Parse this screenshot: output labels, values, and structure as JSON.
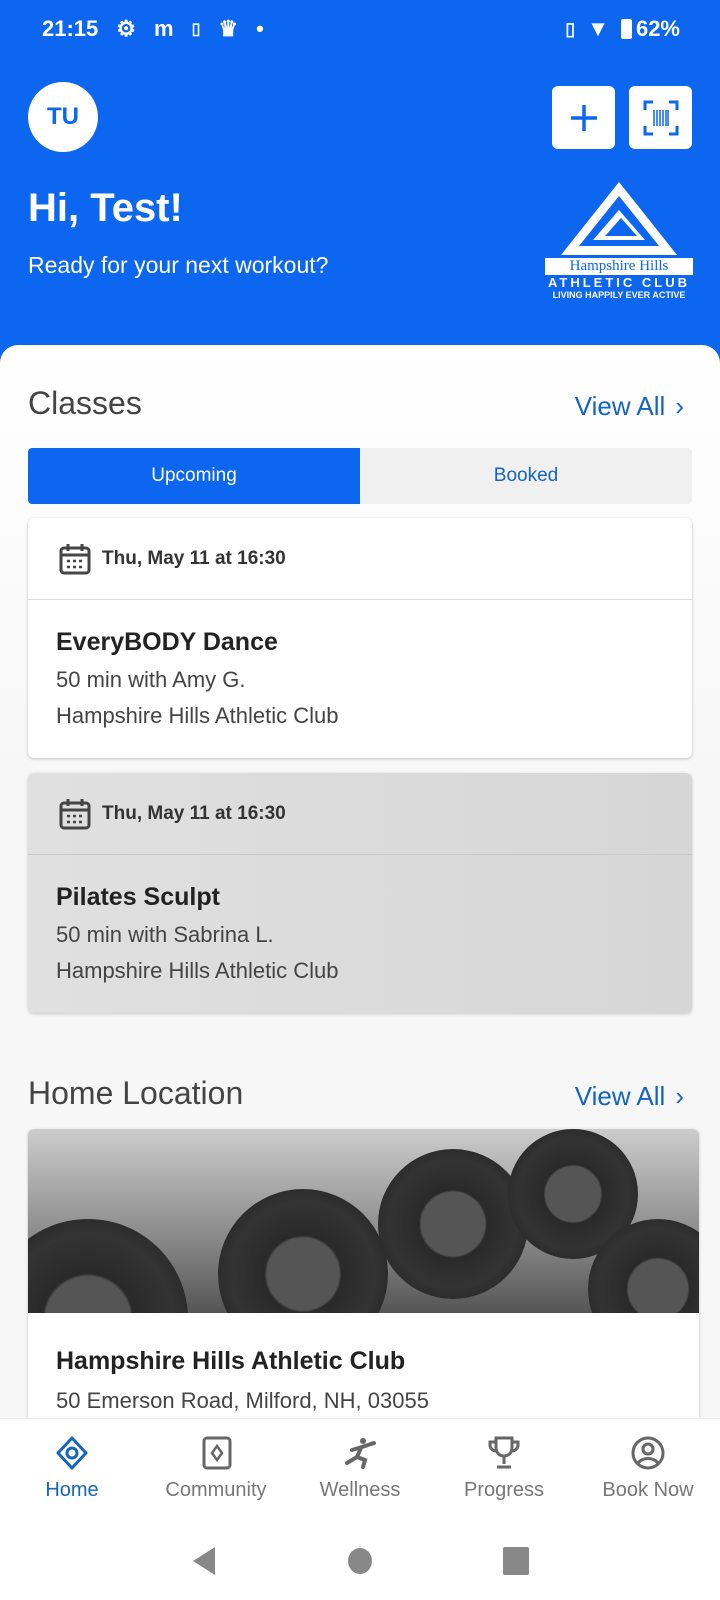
{
  "status_bar": {
    "time": "21:15",
    "battery": "62%"
  },
  "header": {
    "avatar_initials": "TU",
    "greeting": "Hi, Test!",
    "subtitle": "Ready for your next workout?",
    "logo": {
      "line1": "Hampshire Hills",
      "line2": "ATHLETIC CLUB",
      "line3": "LIVING HAPPILY EVER ACTIVE"
    }
  },
  "classes": {
    "title": "Classes",
    "view_all": "View All",
    "tabs": [
      {
        "label": "Upcoming",
        "active": true
      },
      {
        "label": "Booked",
        "active": false
      }
    ],
    "items": [
      {
        "date": "Thu, May 11 at 16:30",
        "name": "EveryBODY Dance",
        "detail": "50 min with Amy G.",
        "location": "Hampshire Hills Athletic Club"
      },
      {
        "date": "Thu, May 11 at 16:30",
        "name": "Pilates Sculpt",
        "detail": "50 min with Sabrina L.",
        "location": "Hampshire Hills Athletic Club"
      }
    ]
  },
  "home_location": {
    "title": "Home Location",
    "view_all": "View All",
    "name": "Hampshire Hills Athletic Club",
    "address": "50 Emerson Road, Milford, NH, 03055"
  },
  "bottom_nav": [
    {
      "label": "Home",
      "icon": "home-icon",
      "active": true
    },
    {
      "label": "Community",
      "icon": "community-icon"
    },
    {
      "label": "Wellness",
      "icon": "wellness-icon"
    },
    {
      "label": "Progress",
      "icon": "trophy-icon"
    },
    {
      "label": "Book Now",
      "icon": "account-icon"
    }
  ],
  "colors": {
    "brand": "#0c66f0",
    "link": "#1565c0"
  }
}
